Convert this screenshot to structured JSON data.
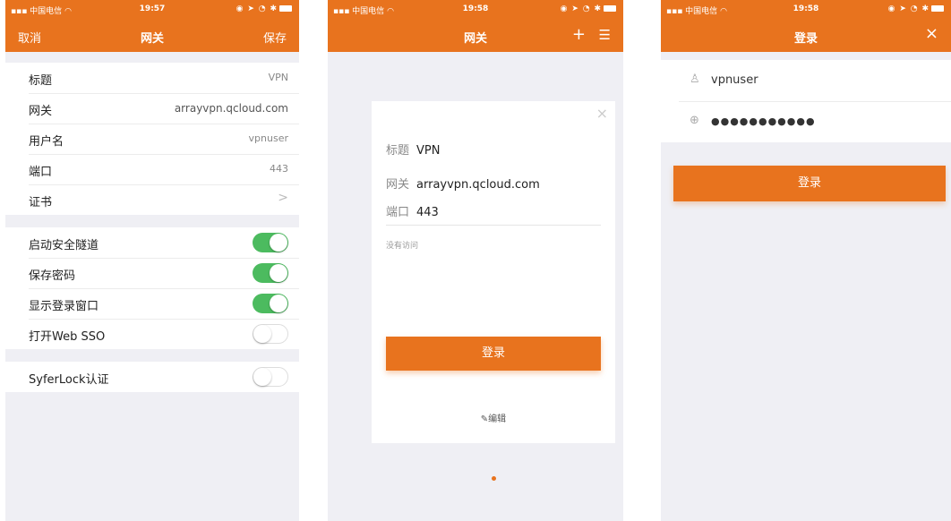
{
  "status": {
    "carrier": "中国电信",
    "time1": "19:57",
    "time2": "19:58",
    "time3": "19:58"
  },
  "screen1": {
    "nav": {
      "left": "取消",
      "title": "网关",
      "right": "保存"
    },
    "fields": [
      {
        "label": "标题",
        "value": "VPN"
      },
      {
        "label": "网关",
        "value": "arrayvpn.qcloud.com"
      },
      {
        "label": "用户名",
        "value": "vpnuser"
      },
      {
        "label": "端口",
        "value": "443"
      },
      {
        "label": "证书",
        "value": ">"
      }
    ],
    "toggles": [
      {
        "label": "启动安全隧道",
        "on": true
      },
      {
        "label": "保存密码",
        "on": true
      },
      {
        "label": "显示登录窗口",
        "on": true
      },
      {
        "label": "打开Web SSO",
        "on": false
      }
    ],
    "syfer": {
      "label": "SyferLock认证",
      "on": false
    }
  },
  "screen2": {
    "nav": {
      "title": "网关",
      "add": "+",
      "menu": "☰"
    },
    "card": {
      "close": "×",
      "title_key": "标题",
      "title_val": "VPN",
      "gw_key": "网关",
      "gw_val": "arrayvpn.qcloud.com",
      "port_key": "端口",
      "port_val": "443",
      "no_access": "没有访问",
      "login": "登录",
      "edit": "✎编辑"
    }
  },
  "screen3": {
    "nav": {
      "title": "登录",
      "close": "×"
    },
    "username": "vpnuser",
    "password": "●●●●●●●●●●●",
    "login": "登录"
  },
  "colors": {
    "accent": "#e8731e",
    "toggle_on": "#4cbb5f",
    "background": "#efeff4"
  }
}
